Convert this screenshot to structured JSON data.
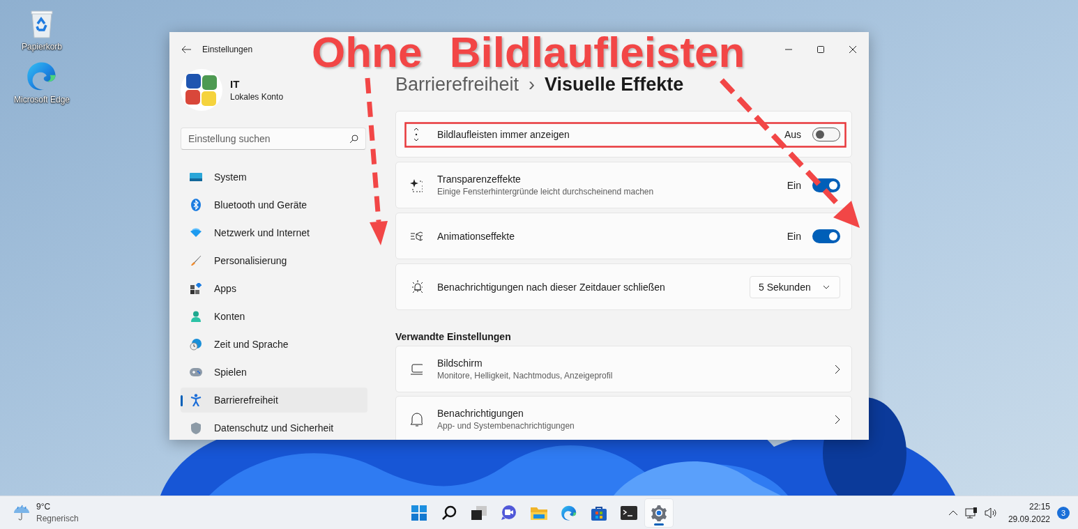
{
  "desktop_icons": [
    {
      "kind": "recycle",
      "label": "Papierkorb"
    },
    {
      "kind": "edge",
      "label": "Microsoft Edge"
    }
  ],
  "window": {
    "title": "Einstellungen"
  },
  "account": {
    "name": "IT",
    "type": "Lokales Konto"
  },
  "search": {
    "placeholder": "Einstellung suchen"
  },
  "nav": [
    {
      "label": "System",
      "selected": false
    },
    {
      "label": "Bluetooth und Geräte",
      "selected": false
    },
    {
      "label": "Netzwerk und Internet",
      "selected": false
    },
    {
      "label": "Personalisierung",
      "selected": false
    },
    {
      "label": "Apps",
      "selected": false
    },
    {
      "label": "Konten",
      "selected": false
    },
    {
      "label": "Zeit und Sprache",
      "selected": false
    },
    {
      "label": "Spielen",
      "selected": false
    },
    {
      "label": "Barrierefreiheit",
      "selected": true
    },
    {
      "label": "Datenschutz und Sicherheit",
      "selected": false
    }
  ],
  "breadcrumb": {
    "parent": "Barrierefreiheit",
    "separator": "›",
    "current": "Visuelle Effekte"
  },
  "settings": [
    {
      "kind": "toggle",
      "label": "Bildlaufleisten immer anzeigen",
      "state_text": "Aus",
      "on": false
    },
    {
      "kind": "toggle",
      "label": "Transparenzeffekte",
      "description": "Einige Fensterhintergründe leicht durchscheinend machen",
      "state_text": "Ein",
      "on": true
    },
    {
      "kind": "toggle",
      "label": "Animationseffekte",
      "state_text": "Ein",
      "on": true
    },
    {
      "kind": "dropdown",
      "label": "Benachrichtigungen nach dieser Zeitdauer schließen",
      "value": "5 Sekunden"
    }
  ],
  "related": {
    "heading": "Verwandte Einstellungen",
    "items": [
      {
        "label": "Bildschirm",
        "description": "Monitore, Helligkeit, Nachtmodus, Anzeigeprofil"
      },
      {
        "label": "Benachrichtigungen",
        "description": "App- und Systembenachrichtigungen"
      }
    ]
  },
  "annotation": {
    "title": "Ohne Bildlaufleisten"
  },
  "taskbar": {
    "weather": {
      "temperature": "9°C",
      "condition": "Regnerisch"
    },
    "apps": [
      {
        "kind": "start",
        "selected": false
      },
      {
        "kind": "search",
        "selected": false
      },
      {
        "kind": "taskview",
        "selected": false
      },
      {
        "kind": "chat",
        "selected": false
      },
      {
        "kind": "explorer",
        "selected": false
      },
      {
        "kind": "edge",
        "selected": false
      },
      {
        "kind": "store",
        "selected": false
      },
      {
        "kind": "terminal",
        "selected": false
      },
      {
        "kind": "settings",
        "selected": true
      }
    ],
    "clock": {
      "time": "22:15",
      "date": "29.09.2022"
    },
    "notifications": "3"
  }
}
